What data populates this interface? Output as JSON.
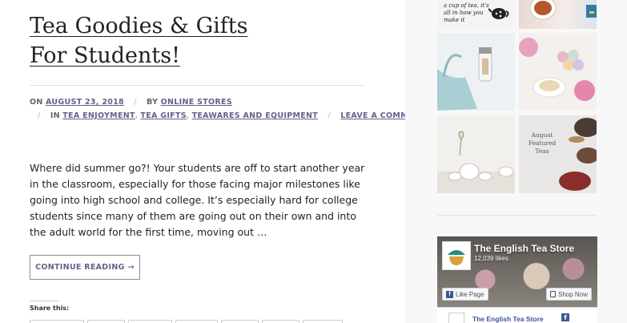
{
  "post": {
    "title_line1": "Tea Goodies & Gifts",
    "title_line2": "For Students!",
    "meta": {
      "on_label": "ON",
      "date": "AUGUST 23, 2018",
      "by_label": "BY",
      "author": "ONLINE STORES",
      "in_label": "IN",
      "categories": [
        "TEA ENJOYMENT",
        "TEA GIFTS",
        "TEAWARES AND EQUIPMENT"
      ],
      "comment_link": "LEAVE A COMMENT"
    },
    "excerpt": "Where did summer go?! Your students are off to start another year in the classroom, especially for those facing major milestones like going into high school and college. It’s especially hard for college students since many of them are going out on their own and into the adult world for the first time, moving out …",
    "read_more": "CONTINUE READING",
    "read_more_arrow": "→",
    "share_label": "Share this:"
  },
  "sidebar": {
    "tile1_text": "a cup of tea, it's all in how you make it",
    "tile6_text": "August Featured Teas",
    "facebook": {
      "page_name": "The English Tea Store",
      "likes": "12,039 likes",
      "like_button": "Like Page",
      "shop_button": "Shop Now",
      "post_author": "The English Tea Store",
      "fb_letter": "f",
      "brand_color": "#3b5998",
      "logo_color": "#1f8f7a"
    }
  }
}
